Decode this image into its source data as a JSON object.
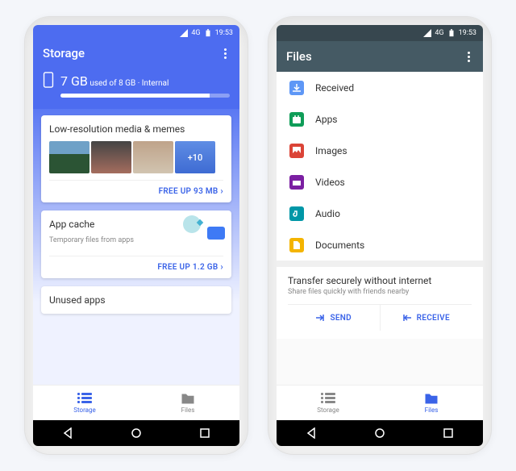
{
  "statusbar": {
    "network": "4G",
    "time": "19:53"
  },
  "phone1": {
    "appbar_title": "Storage",
    "usage_value": "7 GB",
    "usage_suffix": "used of 8 GB · Internal",
    "cards": {
      "low_res": {
        "title": "Low-resolution media & memes",
        "more_count_label": "+10",
        "action": "FREE UP 93 MB"
      },
      "app_cache": {
        "title": "App cache",
        "subtitle": "Temporary files from apps",
        "action": "FREE UP 1.2 GB"
      },
      "unused": {
        "title": "Unused apps"
      }
    },
    "bottomnav": {
      "storage": "Storage",
      "files": "Files"
    }
  },
  "phone2": {
    "appbar_title": "Files",
    "categories": {
      "received": "Received",
      "apps": "Apps",
      "images": "Images",
      "videos": "Videos",
      "audio": "Audio",
      "documents": "Documents"
    },
    "transfer": {
      "title": "Transfer securely without internet",
      "subtitle": "Share files quickly with friends nearby",
      "send": "SEND",
      "receive": "RECEIVE"
    },
    "bottomnav": {
      "storage": "Storage",
      "files": "Files"
    }
  }
}
